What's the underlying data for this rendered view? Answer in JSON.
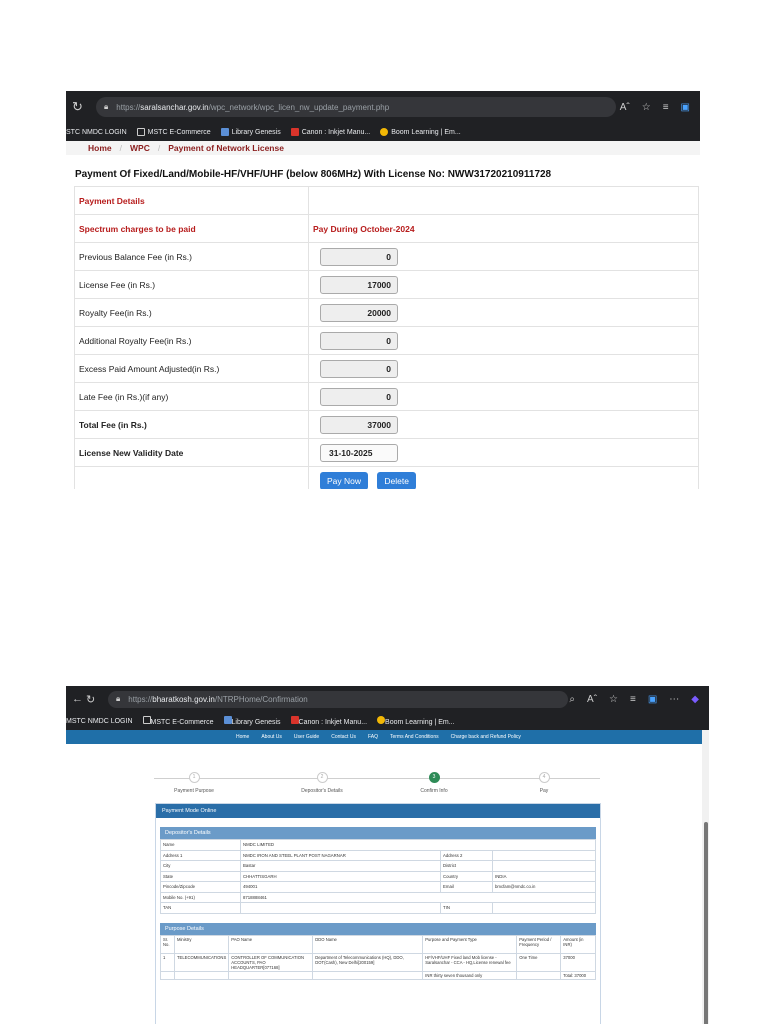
{
  "shot1": {
    "url": {
      "scheme": "https://",
      "host": "saralsanchar.gov.in",
      "path": "/wpc_network/wpc_licen_nw_update_payment.php"
    },
    "bookmarks": [
      "STC NMDC LOGIN",
      "MSTC E-Commerce",
      "Library Genesis",
      "Canon : Inkjet Manu...",
      "Boom Learning | Em..."
    ],
    "breadcrumb": [
      "Home",
      "WPC",
      "Payment of Network License"
    ],
    "title": "Payment Of Fixed/Land/Mobile-HF/VHF/UHF (below 806MHz) With License No: NWW31720210911728",
    "payment_details_label": "Payment Details",
    "spectrum_label": "Spectrum charges to be paid",
    "pay_during": "Pay During October-2024",
    "fees": [
      {
        "label": "Previous Balance Fee (in Rs.)",
        "value": "0"
      },
      {
        "label": "License Fee (in Rs.)",
        "value": "17000"
      },
      {
        "label": "Royalty Fee(in Rs.)",
        "value": "20000"
      },
      {
        "label": "Additional Royalty Fee(in Rs.)",
        "value": "0"
      },
      {
        "label": "Excess Paid Amount Adjusted(in Rs.)",
        "value": "0"
      },
      {
        "label": "Late Fee (in Rs.)(if any)",
        "value": "0"
      }
    ],
    "total_label": "Total Fee (in Rs.)",
    "total_value": "37000",
    "validity_label": "License New Validity Date",
    "validity_value": "31-10-2025",
    "pay_now": "Pay Now",
    "delete": "Delete"
  },
  "shot2": {
    "url": {
      "scheme": "https://",
      "host": "bharatkosh.gov.in",
      "path": "/NTRPHome/Confirmation"
    },
    "bookmarks": [
      "MSTC NMDC LOGIN",
      "MSTC E-Commerce",
      "Library Genesis",
      "Canon : Inkjet Manu...",
      "Boom Learning | Em..."
    ],
    "nav": [
      "Home",
      "About Us",
      "User Guide",
      "Contact Us",
      "FAQ",
      "Terms And Conditions",
      "Charge back and Refund Policy"
    ],
    "steps": [
      {
        "label": "Payment Purpose",
        "num": "1"
      },
      {
        "label": "Depositor's Details",
        "num": "2"
      },
      {
        "label": "Confirm Info",
        "num": "3"
      },
      {
        "label": "Pay",
        "num": "4"
      }
    ],
    "panel_title": "Payment Mode Online",
    "depositor_title": "Depositor's Details",
    "depositor": {
      "name_label": "Name",
      "name": "NMDC LIMITED",
      "addr1_label": "Address 1",
      "addr1": "NMDC IRON AND STEEL PLANT POST NAGARNAR",
      "addr2_label": "Address 2",
      "city_label": "City",
      "city": "Bastar",
      "district_label": "District",
      "state_label": "State",
      "state": "CHHATTISGARH",
      "country_label": "Country",
      "country": "INDIA",
      "pin_label": "Pincode/Zipcode",
      "pin": "494001",
      "email_label": "Email",
      "email": "bmcfam@nmdc.co.in",
      "mobile_label": "Mobile No. (+91)",
      "mobile": "8718888461",
      "tan_label": "TAN",
      "tin_label": "TIN"
    },
    "purpose_title": "Purpose Details",
    "purpose_headers": [
      "Sr. No.",
      "Ministry",
      "PAO Name",
      "DDO Name",
      "Purpose and Payment Type",
      "Payment Period / Frequency",
      "Amount (in INR)"
    ],
    "purpose_row": [
      "1",
      "TELECOMMUNICATIONS",
      "CONTROLLER OF COMMUNICATION ACCOUNTS, PAO HEADQUARTER[077168]",
      "Department of Telecommunications (HQ), DDO, DOT(Cash), New Delhi[200159]",
      "HF/VHF/UHF Fixed land Mob license - Saralsanchar - CCA - HQ,License renewal fee",
      "One Time",
      "37000"
    ],
    "amount_words": "INR thirty seven thousand only",
    "total": "Total: 37000"
  }
}
